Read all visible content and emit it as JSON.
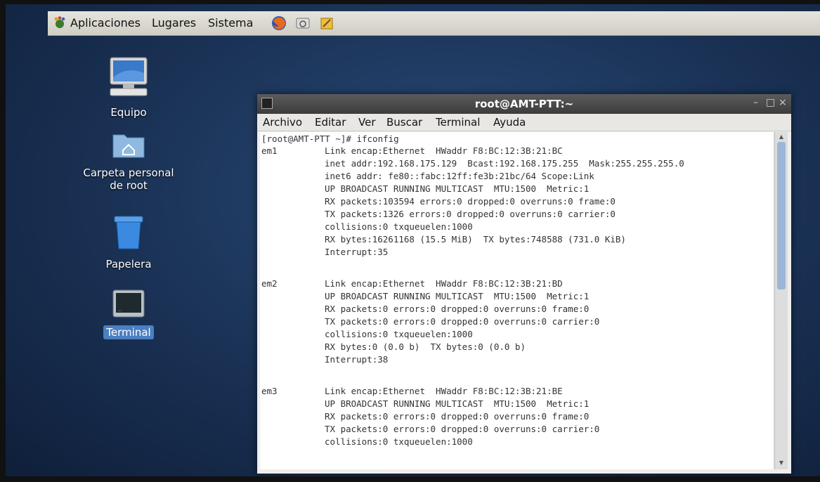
{
  "panel": {
    "menu": [
      "Aplicaciones",
      "Lugares",
      "Sistema"
    ],
    "launchers": [
      "firefox-icon",
      "mail-icon",
      "notes-icon"
    ]
  },
  "desktop": {
    "icons": [
      {
        "label": "Equipo",
        "icon": "computer-icon"
      },
      {
        "label": "Carpeta personal\nde root",
        "icon": "home-folder-icon"
      },
      {
        "label": "Papelera",
        "icon": "trash-icon"
      },
      {
        "label": "Terminal",
        "icon": "terminal-icon",
        "selected": true
      }
    ]
  },
  "terminal": {
    "title": "root@AMT-PTT:~",
    "menu": [
      "Archivo",
      "Editar",
      "Ver",
      "Buscar",
      "Terminal",
      "Ayuda"
    ],
    "prompt": "[root@AMT-PTT ~]# ifconfig",
    "interfaces": [
      {
        "name": "em1",
        "lines": [
          "Link encap:Ethernet  HWaddr F8:BC:12:3B:21:BC",
          "inet addr:192.168.175.129  Bcast:192.168.175.255  Mask:255.255.255.0",
          "inet6 addr: fe80::fabc:12ff:fe3b:21bc/64 Scope:Link",
          "UP BROADCAST RUNNING MULTICAST  MTU:1500  Metric:1",
          "RX packets:103594 errors:0 dropped:0 overruns:0 frame:0",
          "TX packets:1326 errors:0 dropped:0 overruns:0 carrier:0",
          "collisions:0 txqueuelen:1000",
          "RX bytes:16261168 (15.5 MiB)  TX bytes:748588 (731.0 KiB)",
          "Interrupt:35"
        ]
      },
      {
        "name": "em2",
        "lines": [
          "Link encap:Ethernet  HWaddr F8:BC:12:3B:21:BD",
          "UP BROADCAST RUNNING MULTICAST  MTU:1500  Metric:1",
          "RX packets:0 errors:0 dropped:0 overruns:0 frame:0",
          "TX packets:0 errors:0 dropped:0 overruns:0 carrier:0",
          "collisions:0 txqueuelen:1000",
          "RX bytes:0 (0.0 b)  TX bytes:0 (0.0 b)",
          "Interrupt:38"
        ]
      },
      {
        "name": "em3",
        "lines": [
          "Link encap:Ethernet  HWaddr F8:BC:12:3B:21:BE",
          "UP BROADCAST RUNNING MULTICAST  MTU:1500  Metric:1",
          "RX packets:0 errors:0 dropped:0 overruns:0 frame:0",
          "TX packets:0 errors:0 dropped:0 overruns:0 carrier:0",
          "collisions:0 txqueuelen:1000"
        ]
      }
    ]
  }
}
